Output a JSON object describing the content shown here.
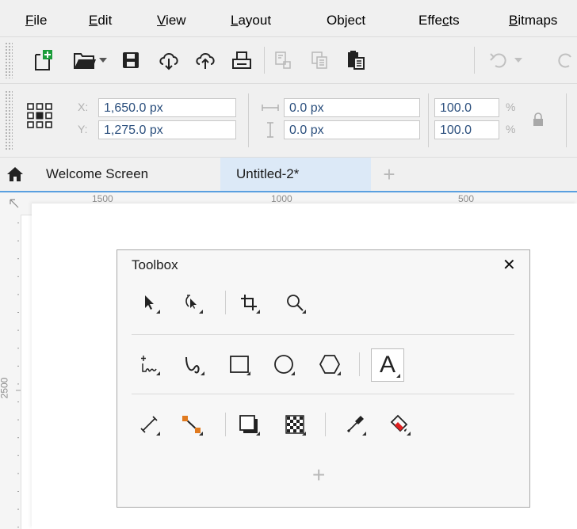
{
  "menubar": {
    "items": [
      {
        "label": "File",
        "accel": "F",
        "rest": "ile"
      },
      {
        "label": "Edit",
        "accel": "E",
        "rest": "dit"
      },
      {
        "label": "View",
        "accel": "V",
        "rest": "iew"
      },
      {
        "label": "Layout",
        "accel": "L",
        "rest": "ayout"
      },
      {
        "label": "Object",
        "accel": "j",
        "pre": "Ob",
        "rest": "ect"
      },
      {
        "label": "Effects",
        "accel": "c",
        "pre": "Effe",
        "rest": "ts"
      },
      {
        "label": "Bitmaps",
        "accel": "B",
        "rest": "itmaps"
      }
    ]
  },
  "propbar": {
    "x_label": "X:",
    "x_value": "1,650.0 px",
    "y_label": "Y:",
    "y_value": "1,275.0 px",
    "w_value": "0.0 px",
    "h_value": "0.0 px",
    "scale_x": "100.0",
    "scale_y": "100.0",
    "percent_1": "%",
    "percent_2": "%"
  },
  "tabs": {
    "welcome": "Welcome Screen",
    "document": "Untitled-2*",
    "add": "+"
  },
  "ruler": {
    "h_ticks": [
      "1500",
      "1000",
      "500"
    ],
    "v_ticks": [
      "2500"
    ]
  },
  "toolbox": {
    "title": "Toolbox",
    "close": "✕",
    "text_tool": "A",
    "add": "+"
  },
  "colors": {
    "accent": "#5aa0e0",
    "active_tab": "#dce9f7",
    "field_text": "#2b4f7d",
    "paint_red": "#e02020"
  }
}
